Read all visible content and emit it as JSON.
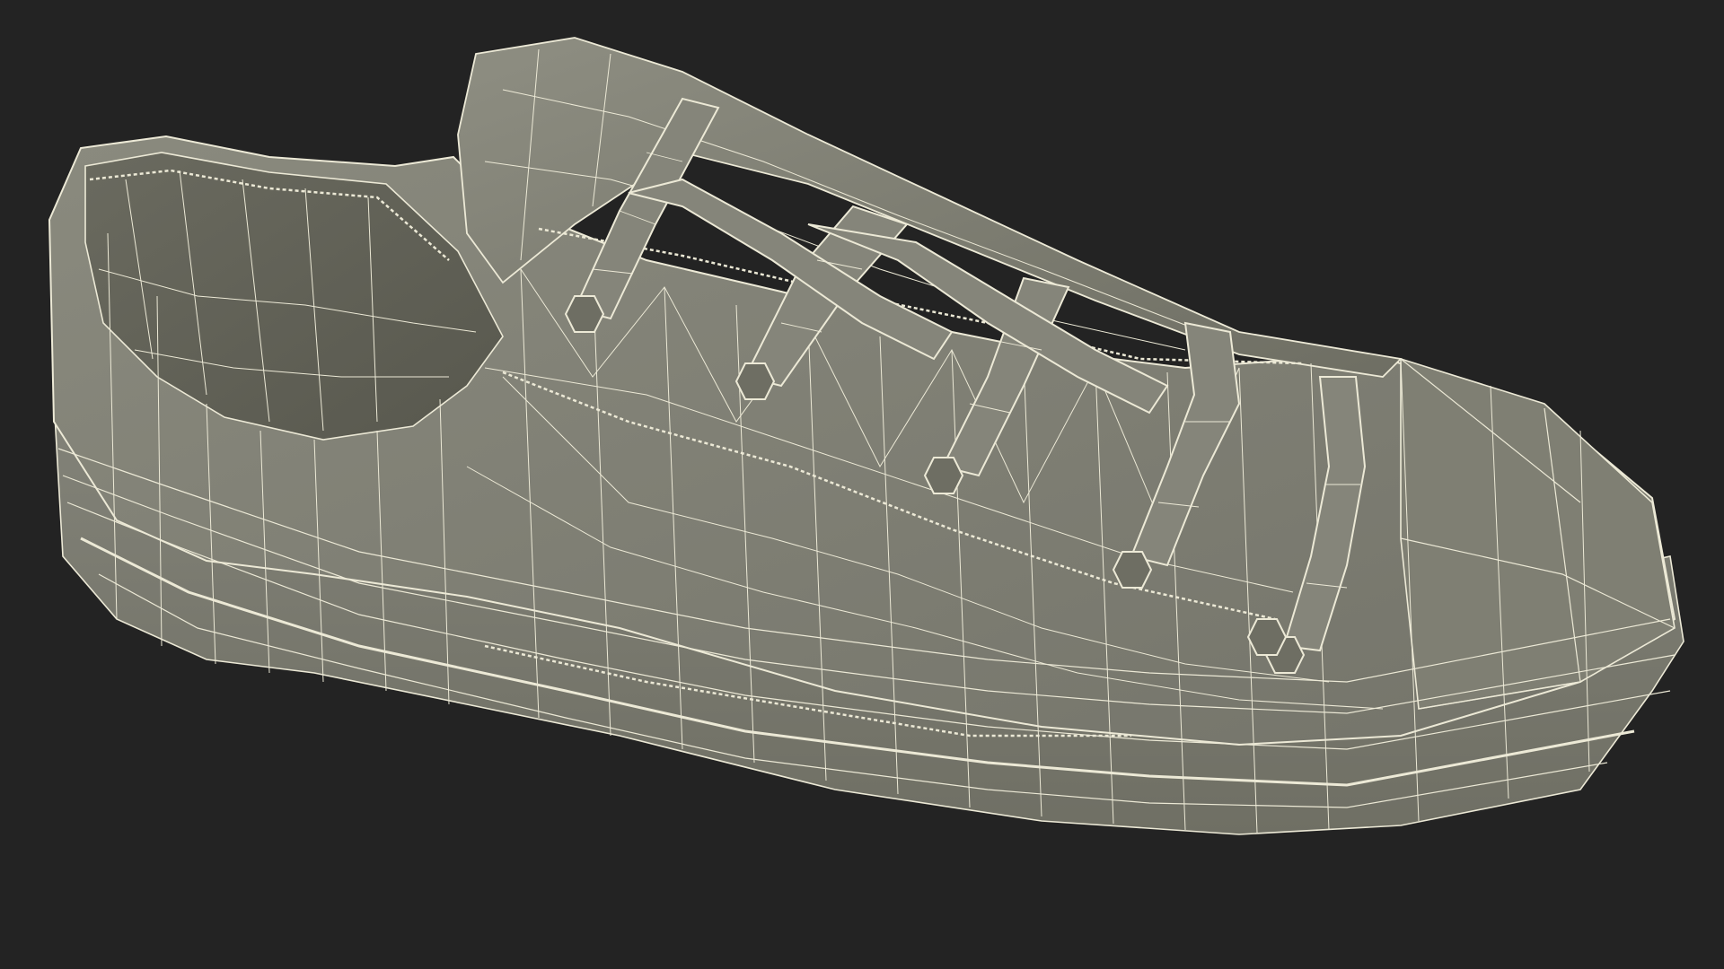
{
  "scene": {
    "background_color": "#232323",
    "model": "sneaker",
    "render_style": "wireframe-over-shaded",
    "surface_color": "#7b7b6e",
    "surface_light_color": "#8a8a7d",
    "surface_dark_color": "#5f5f55",
    "interior_color": "#66665b",
    "wire_color": "#ece9d6"
  }
}
